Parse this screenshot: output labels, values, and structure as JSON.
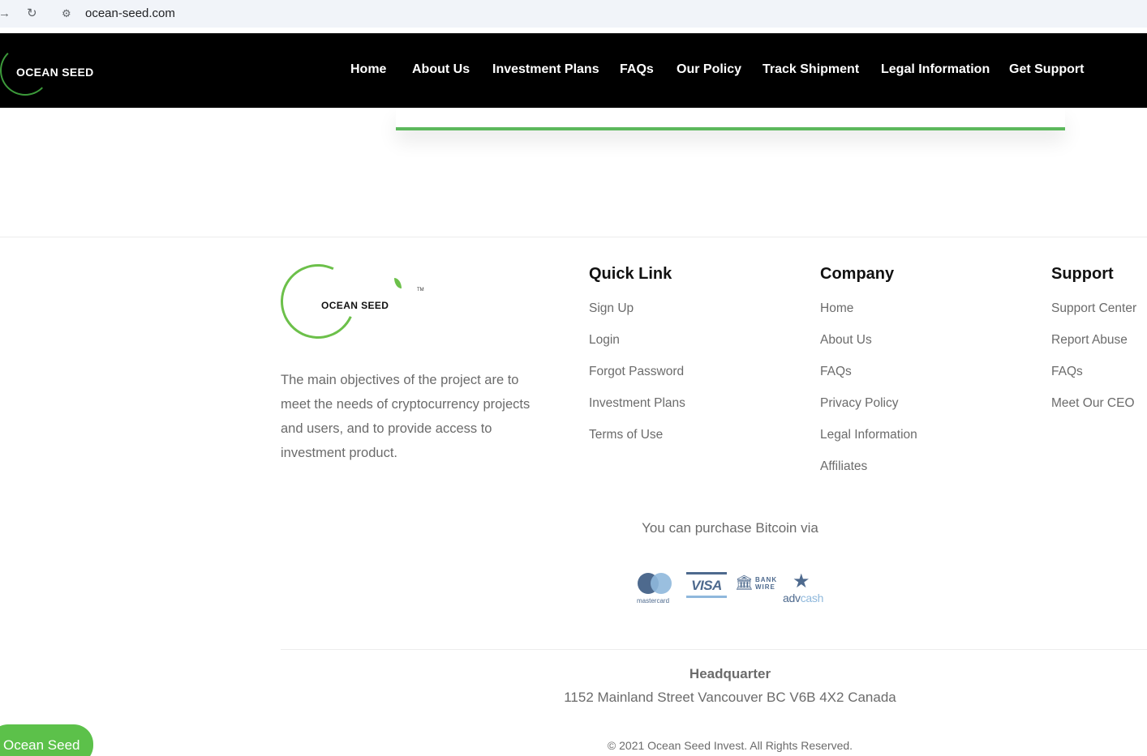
{
  "browser": {
    "url": "ocean-seed.com"
  },
  "header": {
    "logo": "OCEAN SEED",
    "nav": [
      "Home",
      "About Us",
      "Investment Plans",
      "FAQs",
      "Our Policy",
      "Track Shipment",
      "Legal Information",
      "Get Support"
    ]
  },
  "footer": {
    "logo": "OCEAN  SEED",
    "tm": "TM",
    "about": "The main objectives of the project are to meet the needs of cryptocurrency projects and users, and to provide access to investment product.",
    "quick_link": {
      "title": "Quick Link",
      "links": [
        "Sign Up",
        "Login",
        "Forgot Password",
        "Investment Plans",
        "Terms of Use"
      ]
    },
    "company": {
      "title": "Company",
      "links": [
        "Home",
        "About Us",
        "FAQs",
        "Privacy Policy",
        "Legal Information",
        "Affiliates"
      ]
    },
    "support": {
      "title": "Support",
      "links": [
        "Support Center",
        "Report Abuse",
        "FAQs",
        "Meet Our CEO"
      ]
    },
    "purchase_text": "You can purchase Bitcoin via",
    "payments": {
      "mastercard": "mastercard",
      "visa": "VISA",
      "bank_line1": "BANK",
      "bank_line2": "WIRE",
      "adv": "adv",
      "cash": "cash"
    },
    "hq_title": "Headquarter",
    "hq_address": "1152 Mainland Street Vancouver BC V6B 4X2 Canada",
    "copyright": "© 2021 Ocean Seed Invest. All Rights Reserved."
  },
  "chat_button": "Ocean Seed"
}
